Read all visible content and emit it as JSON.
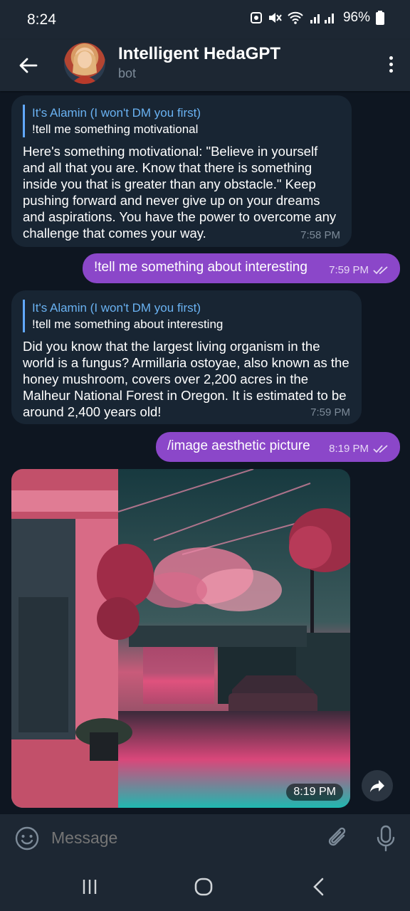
{
  "status_bar": {
    "time": "8:24",
    "battery": "96%"
  },
  "header": {
    "title": "Intelligent HedaGPT",
    "subtitle": "bot"
  },
  "messages": [
    {
      "reply_name": "It's Alamin (I won't DM you first)",
      "reply_text": "!tell me something motivational",
      "text": "Here's something motivational: \"Believe in yourself and all that you are. Know that there is something inside you that is greater than any obstacle.\" Keep pushing forward and never give up on your dreams and aspirations. You have the power to overcome any challenge that comes your way.",
      "time": "7:58 PM"
    },
    {
      "text": "!tell me something about interesting",
      "time": "7:59 PM"
    },
    {
      "reply_name": "It's Alamin (I won't DM you first)",
      "reply_text": "!tell me something about interesting",
      "text": "Did you know that the largest living organism in the world is a fungus? Armillaria ostoyae, also known as the honey mushroom, covers over 2,200 acres in the Malheur National Forest in Oregon. It is estimated to be around 2,400 years old!",
      "time": "7:59 PM"
    },
    {
      "text": "/image aesthetic picture",
      "time": "8:19 PM"
    },
    {
      "image": "aesthetic-picture",
      "time": "8:19 PM"
    }
  ],
  "input": {
    "placeholder": "Message"
  },
  "colors": {
    "background": "#0e1621",
    "bar": "#1d2733",
    "incoming": "#182533",
    "outgoing": "#8b47c9",
    "link": "#6ab2f2"
  }
}
